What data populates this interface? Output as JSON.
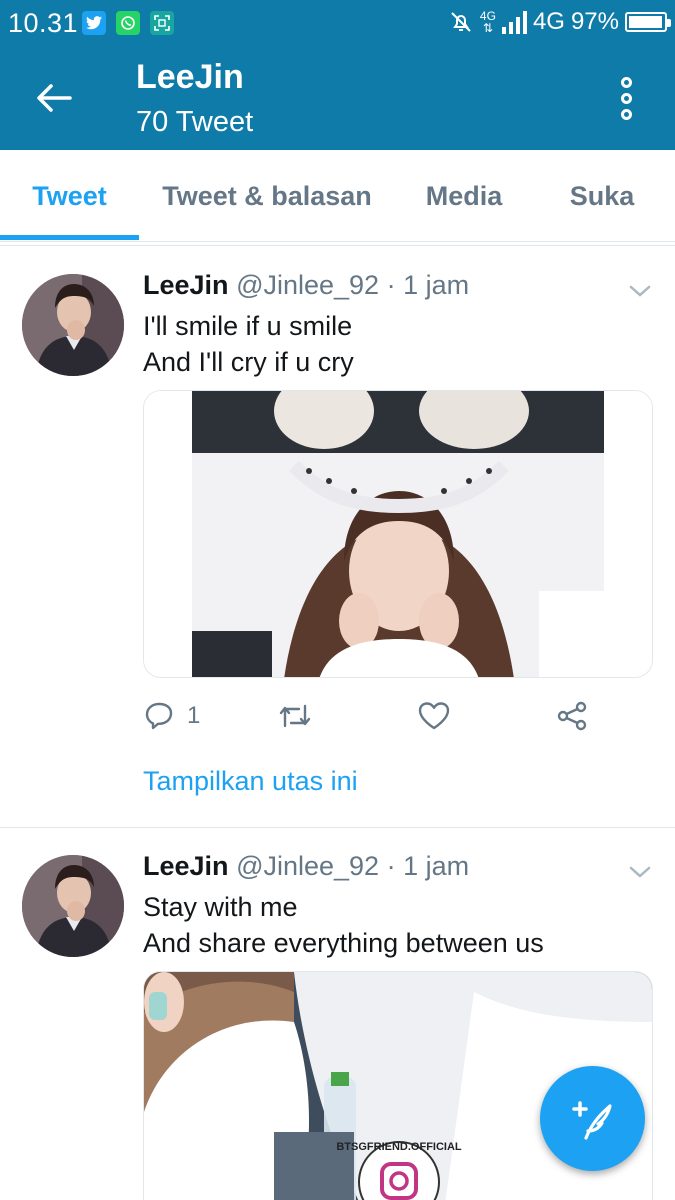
{
  "status_bar": {
    "time": "10.31",
    "app_icons": [
      "twitter-icon",
      "whatsapp-icon",
      "scan-icon"
    ],
    "network_small": "4G",
    "network": "4G",
    "battery": "97%",
    "battery_level": 0.97
  },
  "header": {
    "title": "LeeJin",
    "subtitle": "70 Tweet"
  },
  "tabs": [
    {
      "label": "Tweet",
      "active": true
    },
    {
      "label": "Tweet & balasan",
      "active": false
    },
    {
      "label": "Media",
      "active": false
    },
    {
      "label": "Suka",
      "active": false
    }
  ],
  "tweets": [
    {
      "name": "LeeJin",
      "handle": "@Jinlee_92",
      "separator": "·",
      "time": "1 jam",
      "lines": [
        "I'll smile if u smile",
        "And I'll cry if u cry"
      ],
      "reply_count": "1",
      "thread_link": "Tampilkan utas ini"
    },
    {
      "name": "LeeJin",
      "handle": "@Jinlee_92",
      "separator": "·",
      "time": "1 jam",
      "lines": [
        "Stay with me",
        "And share everything between us"
      ],
      "watermark": "BTSGFRIEND.OFFICIAL"
    }
  ],
  "colors": {
    "brand": "#0f7ba8",
    "accent": "#1da1f2",
    "muted": "#657786"
  }
}
